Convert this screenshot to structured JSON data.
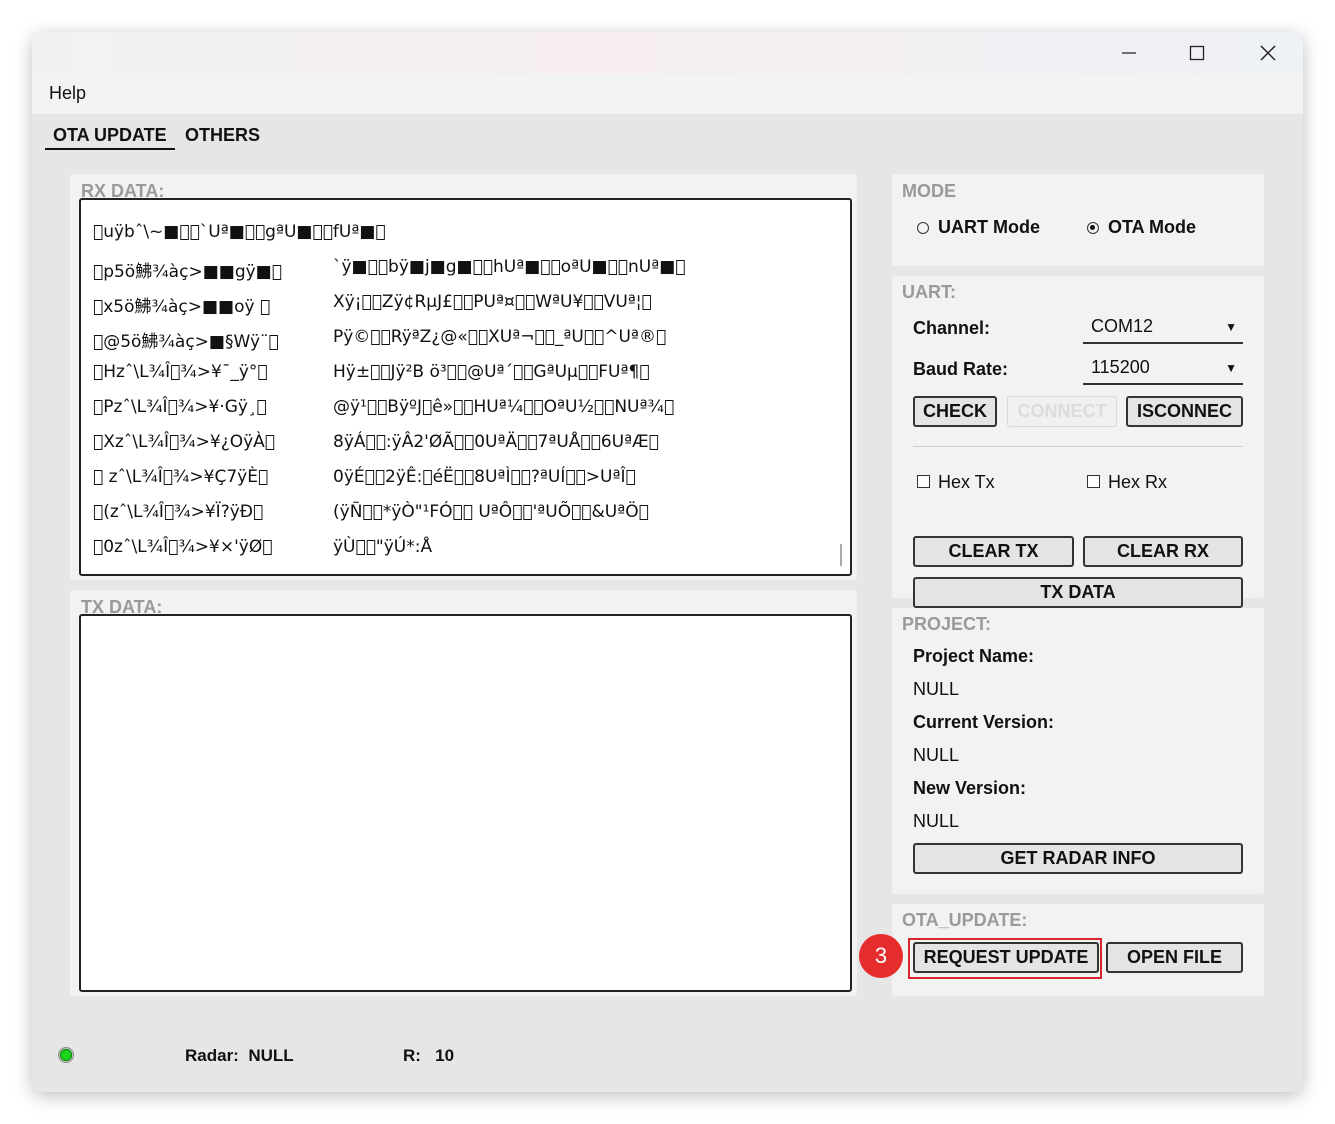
{
  "window": {
    "controls": {
      "minimize": "minimize-icon",
      "maximize": "maximize-icon",
      "close": "close-icon"
    }
  },
  "menu": {
    "help": "Help"
  },
  "tabs": [
    {
      "label": "OTA UPDATE",
      "active": true
    },
    {
      "label": "OTHERS",
      "active": false
    }
  ],
  "rx": {
    "title": "RX DATA:",
    "lines": [
      {
        "a": "\u0000uÿ­bˆ\\~■\u0000\u0000`Uª■\u0000\u0000gªU■\u0000\u0000fUª■\u0000",
        "b": ""
      },
      {
        "a": "\u0000p5ö鮄¾àç>■■gÿ■\u0000",
        "b": "`ÿ■\u0000\u0000bÿ■j■g■\u0000\u0000hUª■\u0000\u0000oªU■\u0000\u0000nUª■\u0000"
      },
      {
        "a": "\u0000x5ö鮄¾àç>■■oÿ \u0000",
        "b": "Xÿ¡\u0000\u0000Zÿ¢RµJ£\u0000\u0000PUª¤\u0000\u0000WªU¥\u0000\u0000VUª¦\u0000"
      },
      {
        "a": "\u0000@5ö鮄¾àç>■§Wÿ¨\u0000",
        "b": "Pÿ©\u0000\u0000RÿªZ¿@«\u0000\u0000XUª¬\u0000\u0000_ªU\u0000\u0000^Uª®\u0000"
      },
      {
        "a": "\u0000Hzˆ\\L¾Î\u0000¾>¥¯_ÿ°\u0000",
        "b": "Hÿ±\u0000\u0000Jÿ²B            ö³\u0000\u0000@Uª´\u0000\u0000GªUµ\u0000\u0000FUª¶\u0000"
      },
      {
        "a": "\u0000Pzˆ\\L¾Î\u0000¾>¥·Gÿ¸\u0000",
        "b": "@ÿ¹\u0000\u0000BÿºJ\u0000ê»\u0000\u0000HUª¼\u0000\u0000OªU½\u0000\u0000NUª¾\u0000"
      },
      {
        "a": "\u0000Xzˆ\\L¾Î\u0000¾>¥¿OÿÀ\u0000",
        "b": "8ÿÁ\u0000\u0000:ÿÂ2'ØÃ\u0000\u00000UªÄ\u0000\u00007ªUÅ\u0000\u00006UªÆ\u0000"
      },
      {
        "a": "\u0000 zˆ\\L¾Î\u0000¾>¥Ç7ÿÈ\u0000",
        "b": "0ÿÉ\u0000\u00002ÿÊ:\u0000éË\u0000\u00008UªÌ\u0000\u0000?ªUÍ\u0000\u0000>UªÎ\u0000"
      },
      {
        "a": "\u0000(zˆ\\L¾Î\u0000¾>¥Ï?ÿÐ\u0000",
        "b": "(ÿÑ\u0000\u0000*ÿÒ\"¹FÓ\u0000\u0000 UªÔ\u0000\u0000'ªUÕ\u0000\u0000&UªÖ\u0000"
      },
      {
        "a": "\u00000zˆ\\L¾Î\u0000¾>¥×'ÿØ\u0000",
        "b": " ÿÙ\u0000\u0000\"ÿÚ*:Å"
      }
    ]
  },
  "tx": {
    "title": "TX DATA:",
    "value": ""
  },
  "mode": {
    "title": "MODE",
    "uart_label": "UART Mode",
    "ota_label": "OTA Mode",
    "selected": "OTA Mode"
  },
  "uart": {
    "title": "UART:",
    "channel_label": "Channel:",
    "channel_value": "COM12",
    "baud_label": "Baud Rate:",
    "baud_value": "115200",
    "check_btn": "CHECK",
    "connect_btn": "CONNECT",
    "disconnect_btn": "ISCONNEC",
    "hex_tx_label": "Hex Tx",
    "hex_rx_label": "Hex Rx",
    "clear_tx_btn": "CLEAR TX",
    "clear_rx_btn": "CLEAR RX",
    "tx_data_btn": "TX DATA"
  },
  "project": {
    "title": "PROJECT:",
    "name_label": "Project Name:",
    "name_value": "NULL",
    "current_label": "Current Version:",
    "current_value": "NULL",
    "new_label": "New Version:",
    "new_value": "NULL",
    "radar_btn": "GET RADAR INFO"
  },
  "ota": {
    "title": "OTA_UPDATE:",
    "request_btn": "REQUEST UPDATE",
    "open_btn": "OPEN FILE"
  },
  "status": {
    "radar_label": "Radar:",
    "radar_value": "NULL",
    "r_label": "R:",
    "r_value": "10",
    "led_color": "#1ed51e"
  },
  "annotation": {
    "step": "3",
    "color": "#e52d2d"
  }
}
